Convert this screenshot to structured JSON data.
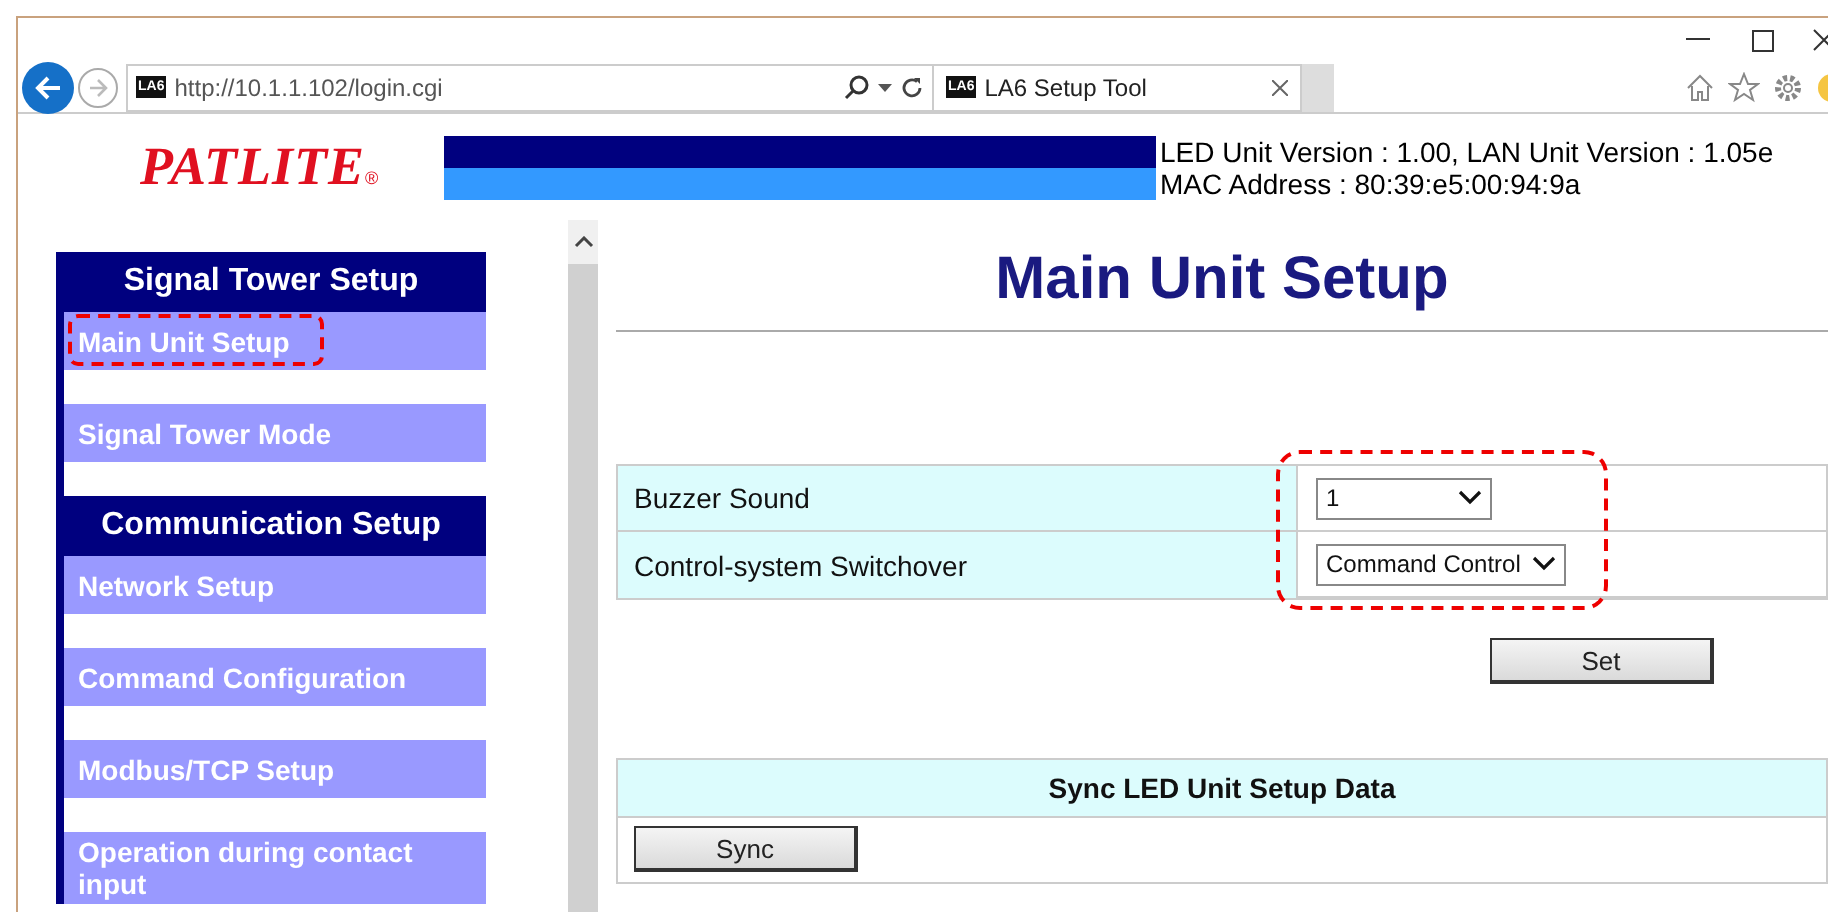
{
  "browser": {
    "address": {
      "favicon": "LA6",
      "url": "http://10.1.1.102/login.cgi"
    },
    "tab": {
      "favicon": "LA6",
      "title": "LA6 Setup Tool",
      "selected": true
    }
  },
  "header": {
    "logo": "PATLITE",
    "registered": "®",
    "version": "LED Unit Version : 1.00, LAN Unit Version : 1.05e",
    "mac": "MAC Address : 80:39:e5:00:94:9a"
  },
  "sidebar": {
    "sections": [
      {
        "title": "Signal Tower Setup",
        "items": [
          {
            "label": "Main Unit Setup",
            "highlighted": true
          },
          {
            "label": "Signal Tower Mode",
            "highlighted": false
          }
        ]
      },
      {
        "title": "Communication Setup",
        "items": [
          {
            "label": "Network Setup",
            "highlighted": false
          },
          {
            "label": "Command Configuration",
            "highlighted": false
          },
          {
            "label": "Modbus/TCP Setup",
            "highlighted": false
          },
          {
            "label": "Operation during contact input",
            "highlighted": false
          }
        ]
      }
    ]
  },
  "main": {
    "title": "Main Unit Setup",
    "settings": {
      "highlighted": true,
      "rows": [
        {
          "label": "Buzzer Sound",
          "value": "1"
        },
        {
          "label": "Control-system Switchover",
          "value": "Command Control"
        }
      ]
    },
    "set_button": "Set",
    "sync": {
      "title": "Sync LED Unit Setup Data",
      "button": "Sync"
    }
  }
}
